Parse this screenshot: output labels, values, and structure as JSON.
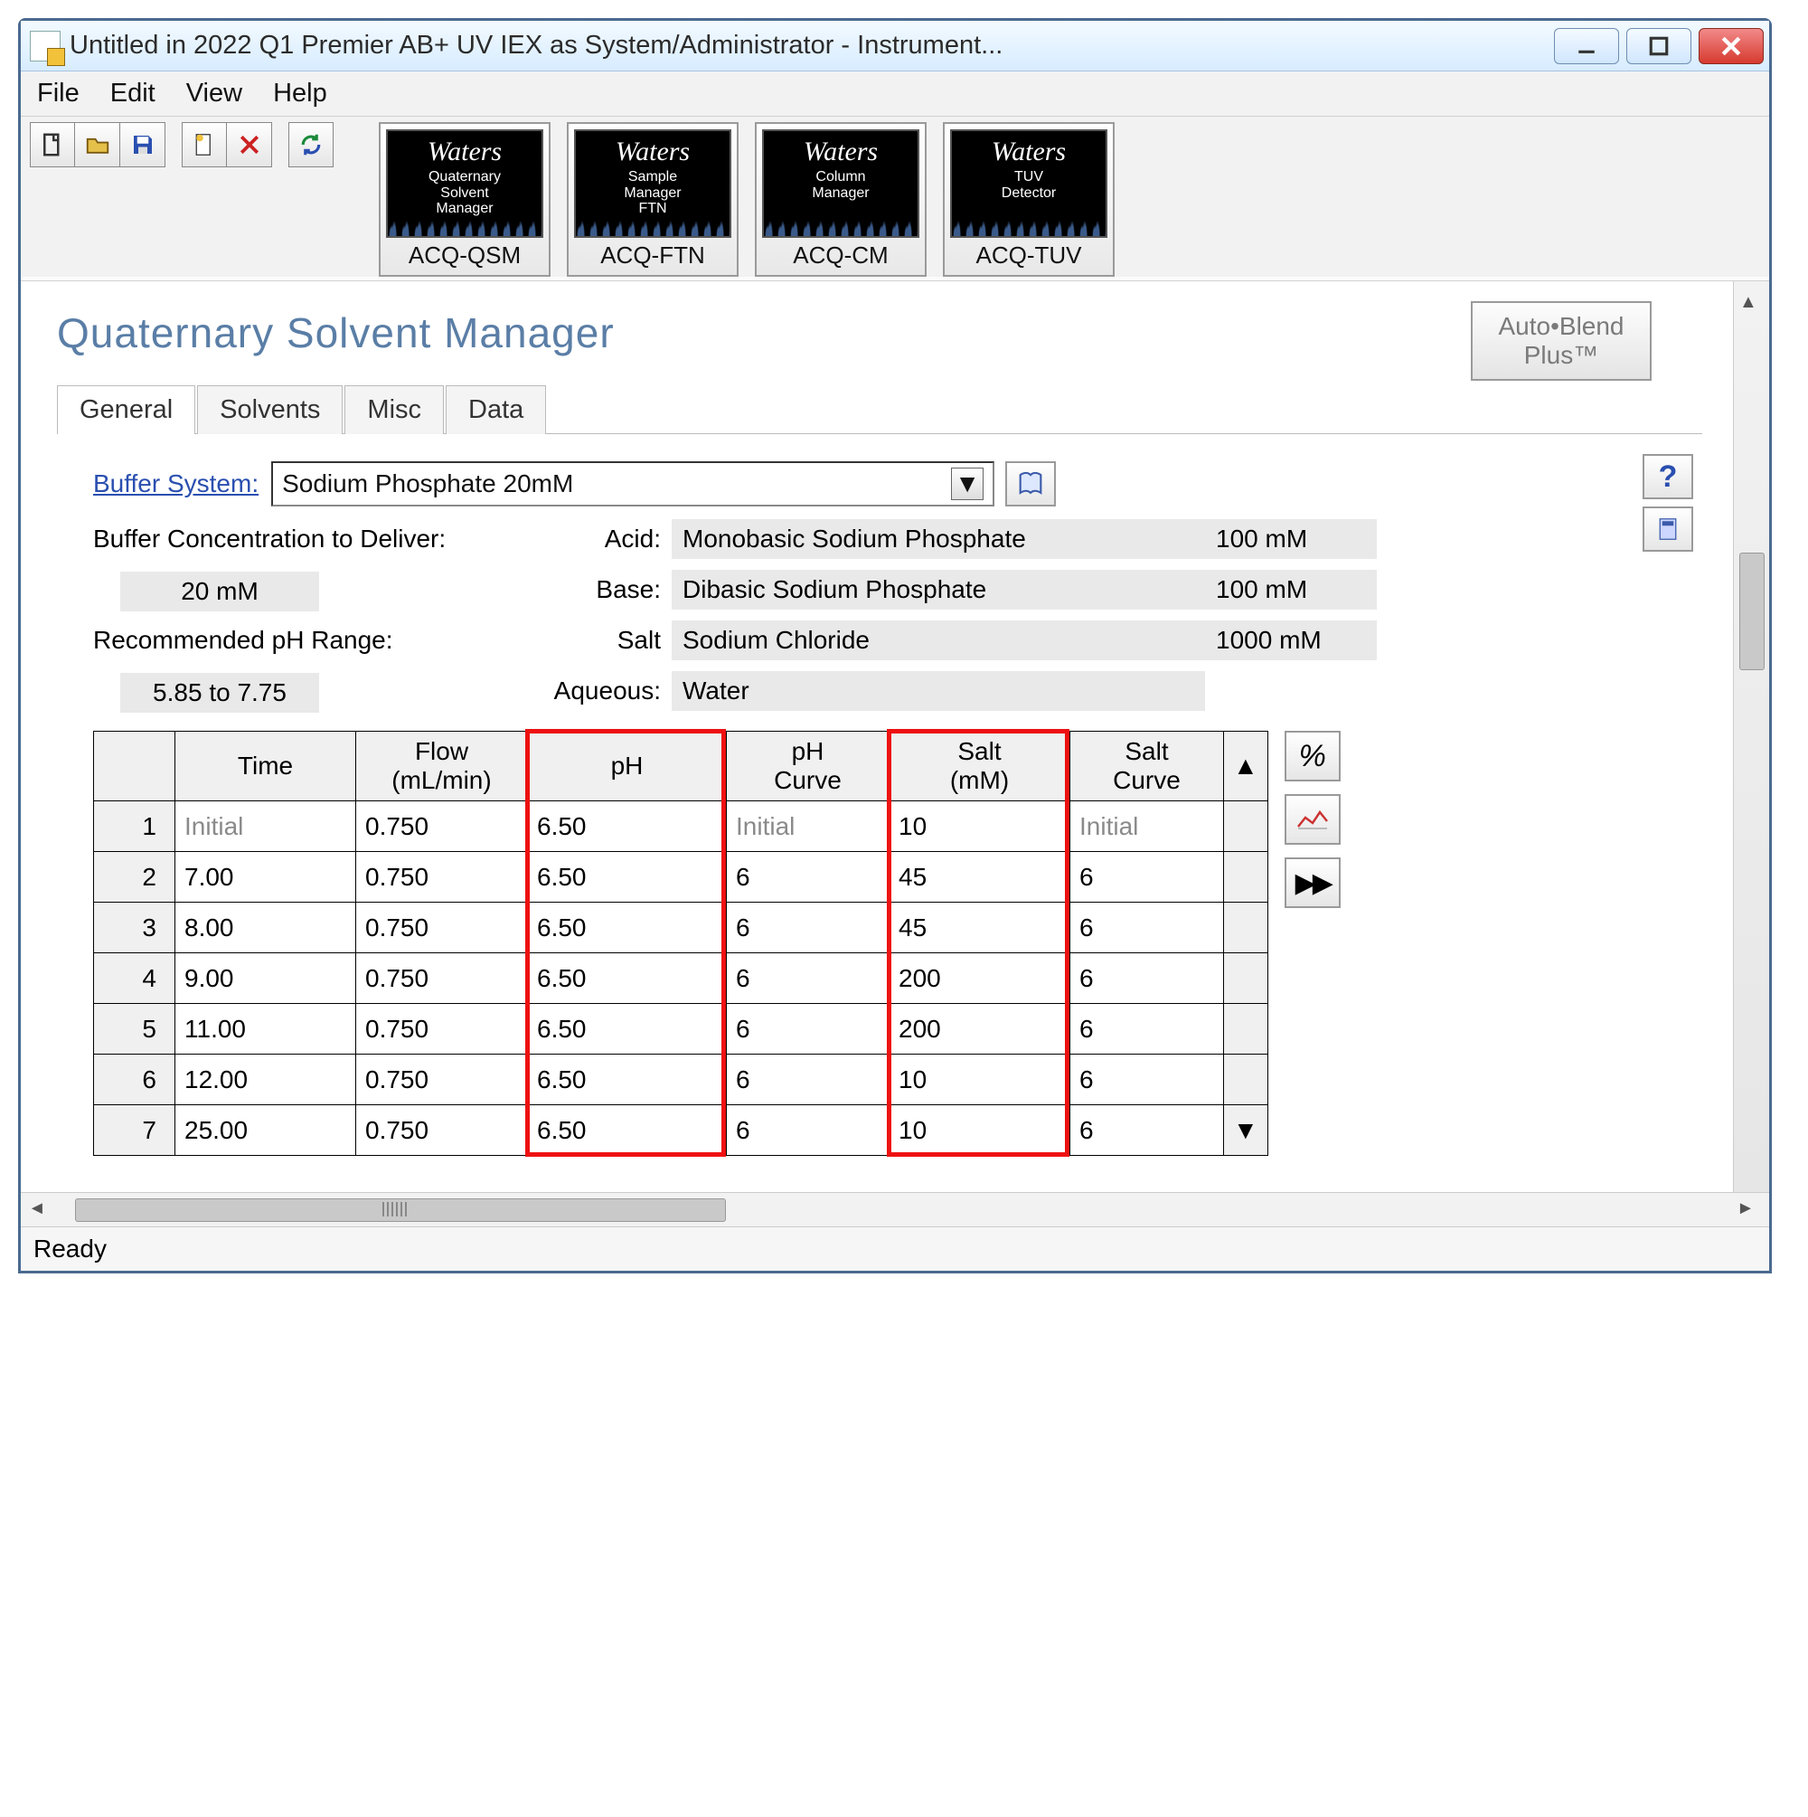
{
  "window": {
    "title": "Untitled in 2022 Q1 Premier AB+ UV IEX as System/Administrator - Instrument..."
  },
  "menu": {
    "file": "File",
    "edit": "Edit",
    "view": "View",
    "help": "Help"
  },
  "instruments": [
    {
      "brand": "Waters",
      "sub": "Quaternary\nSolvent\nManager",
      "caption": "ACQ-QSM"
    },
    {
      "brand": "Waters",
      "sub": "Sample\nManager\nFTN",
      "caption": "ACQ-FTN"
    },
    {
      "brand": "Waters",
      "sub": "Column\nManager",
      "caption": "ACQ-CM"
    },
    {
      "brand": "Waters",
      "sub": "TUV\nDetector",
      "caption": "ACQ-TUV"
    }
  ],
  "panel": {
    "title": "Quaternary Solvent Manager",
    "autoblend": "Auto•Blend\nPlus™",
    "tabs": {
      "general": "General",
      "solvents": "Solvents",
      "misc": "Misc",
      "data": "Data"
    },
    "buffer_label": "Buffer System:",
    "buffer_value": "Sodium Phosphate 20mM",
    "conc_label": "Buffer Concentration to Deliver:",
    "conc_value": "20 mM",
    "ph_range_label": "Recommended pH Range:",
    "ph_range_value": "5.85 to 7.75",
    "acid_label": "Acid:",
    "acid_name": "Monobasic Sodium Phosphate",
    "acid_conc": "100 mM",
    "base_label": "Base:",
    "base_name": "Dibasic Sodium Phosphate",
    "base_conc": "100 mM",
    "salt_label": "Salt",
    "salt_name": "Sodium Chloride",
    "salt_conc": "1000 mM",
    "aq_label": "Aqueous:",
    "aq_name": "Water"
  },
  "grad": {
    "headers": {
      "time": "Time",
      "flow": "Flow\n(mL/min)",
      "ph": "pH",
      "phc": "pH\nCurve",
      "salt": "Salt\n(mM)",
      "saltc": "Salt\nCurve"
    },
    "rows": [
      {
        "n": "1",
        "time": "Initial",
        "flow": "0.750",
        "ph": "6.50",
        "phc": "Initial",
        "salt": "10",
        "saltc": "Initial",
        "init": true
      },
      {
        "n": "2",
        "time": "7.00",
        "flow": "0.750",
        "ph": "6.50",
        "phc": "6",
        "salt": "45",
        "saltc": "6"
      },
      {
        "n": "3",
        "time": "8.00",
        "flow": "0.750",
        "ph": "6.50",
        "phc": "6",
        "salt": "45",
        "saltc": "6"
      },
      {
        "n": "4",
        "time": "9.00",
        "flow": "0.750",
        "ph": "6.50",
        "phc": "6",
        "salt": "200",
        "saltc": "6"
      },
      {
        "n": "5",
        "time": "11.00",
        "flow": "0.750",
        "ph": "6.50",
        "phc": "6",
        "salt": "200",
        "saltc": "6"
      },
      {
        "n": "6",
        "time": "12.00",
        "flow": "0.750",
        "ph": "6.50",
        "phc": "6",
        "salt": "10",
        "saltc": "6"
      },
      {
        "n": "7",
        "time": "25.00",
        "flow": "0.750",
        "ph": "6.50",
        "phc": "6",
        "salt": "10",
        "saltc": "6"
      }
    ]
  },
  "side_buttons": {
    "percent": "%",
    "chart": "chart",
    "play": "▶▶"
  },
  "status": "Ready"
}
